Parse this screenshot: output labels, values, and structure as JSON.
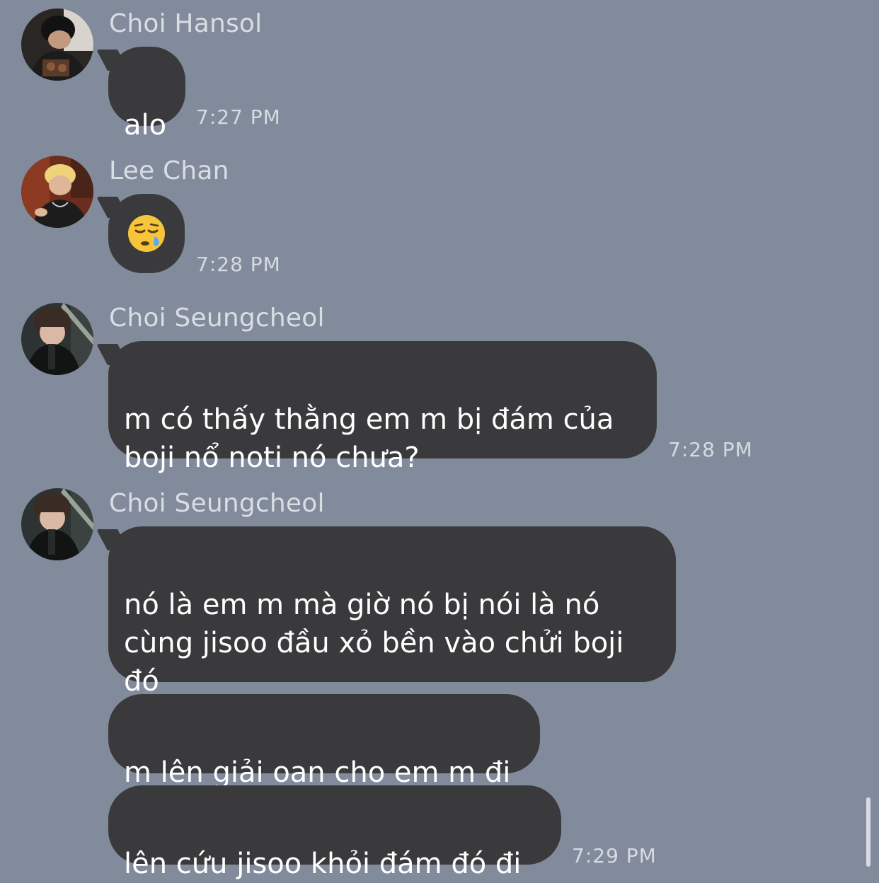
{
  "messages": [
    {
      "sender": "Choi Hansol",
      "avatar": "avatar-choi-hansol",
      "text": "alo",
      "time": "7:27 PM"
    },
    {
      "sender": "Lee Chan",
      "avatar": "avatar-lee-chan",
      "text": "😪",
      "emoji_name": "sleepy-face-emoji",
      "time": "7:28 PM"
    },
    {
      "sender": "Choi Seungcheol",
      "avatar": "avatar-choi-seungcheol",
      "text": "m có thấy thằng em m bị đám của\nboji nổ noti nó chưa?",
      "time": "7:28 PM"
    },
    {
      "sender": "Choi Seungcheol",
      "avatar": "avatar-choi-seungcheol",
      "text": "nó là em m mà giờ nó bị nói là nó\ncùng jisoo đầu xỏ bền vào chửi boji\nđó"
    },
    {
      "text": "m lên giải oan cho em m đi"
    },
    {
      "text": "lên cứu jisoo khỏi đám đó đi",
      "time": "7:29 PM"
    }
  ],
  "colors": {
    "background": "#828b9b",
    "bubble": "#3a3a3c",
    "bubble_text": "#ffffff",
    "sender_text": "#d9dde4",
    "time_text": "#d6dae1"
  }
}
